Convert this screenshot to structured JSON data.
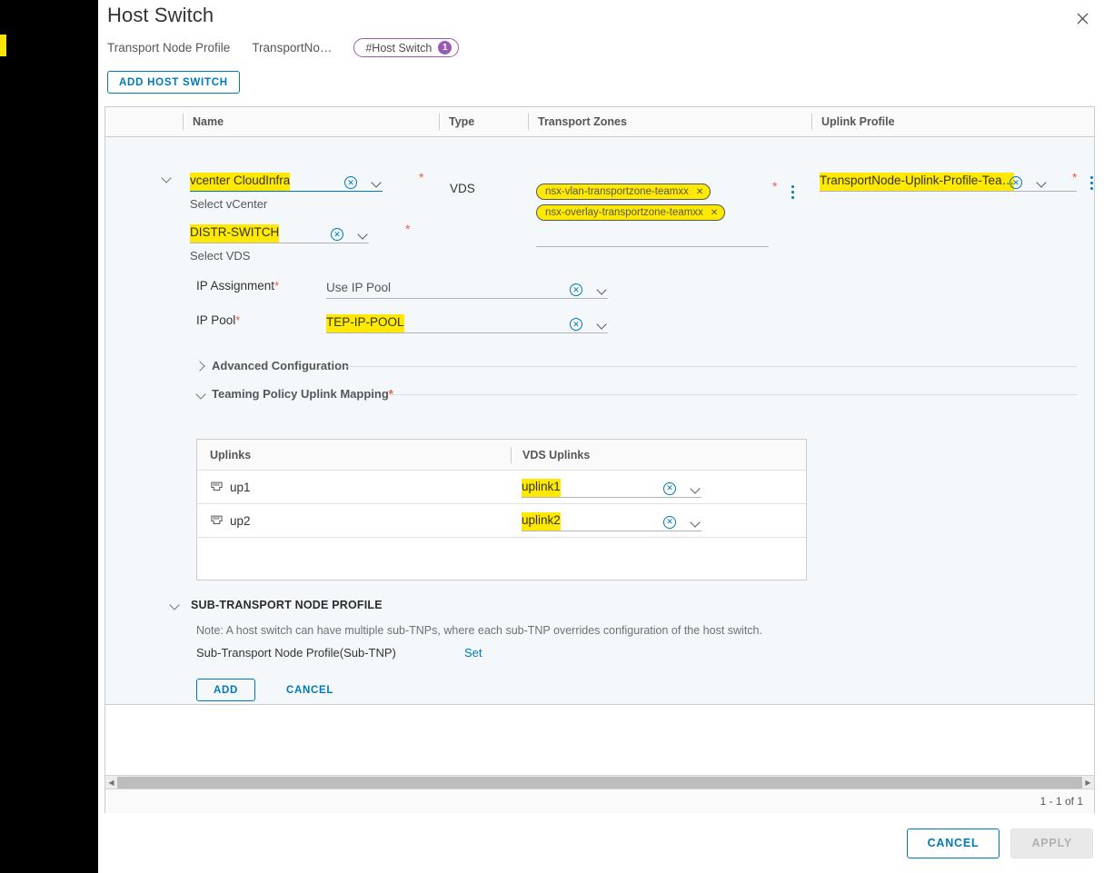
{
  "window": {
    "title": "Host Switch",
    "close_icon": "close-icon"
  },
  "breadcrumb": {
    "items": [
      {
        "label": "Transport Node Profile"
      },
      {
        "label": "TransportNo…"
      }
    ],
    "badge": {
      "label": "#Host Switch",
      "count": "1",
      "color": "#9b59b6"
    }
  },
  "toolbar": {
    "add_host_switch_label": "ADD HOST SWITCH"
  },
  "grid": {
    "columns": [
      {
        "key": "expand",
        "label": ""
      },
      {
        "key": "name",
        "label": "Name"
      },
      {
        "key": "type",
        "label": "Type"
      },
      {
        "key": "transport_zones",
        "label": "Transport Zones"
      },
      {
        "key": "uplink_profile",
        "label": "Uplink Profile"
      }
    ],
    "row": {
      "vcenter": {
        "value": "vcenter CloudInfra",
        "helper": "Select vCenter",
        "required": "*",
        "highlight": "#ffe900"
      },
      "vds": {
        "value": "DISTR-SWITCH",
        "helper": "Select VDS",
        "required": "*",
        "highlight": "#ffe900"
      },
      "type": "VDS",
      "transport_zones": [
        {
          "label": "nsx-vlan-transportzone-teamxx"
        },
        {
          "label": "nsx-overlay-transportzone-teamxx"
        }
      ],
      "transport_zones_required": "*",
      "uplink_profile": {
        "value": "TransportNode-Uplink-Profile-Tea…",
        "required": "*",
        "highlight": "#ffe900"
      }
    },
    "footer": {
      "pagination": "1 - 1 of 1"
    }
  },
  "form": {
    "ip_assignment": {
      "label": "IP Assignment",
      "required": "*",
      "value": "Use IP Pool"
    },
    "ip_pool": {
      "label": "IP Pool",
      "required": "*",
      "value": "TEP-IP-POOL",
      "highlight": "#ffe900"
    },
    "advanced_configuration": {
      "label": "Advanced Configuration",
      "expanded": "collapsed"
    },
    "teaming_policy": {
      "label": "Teaming Policy Uplink Mapping",
      "required": "*",
      "expanded": "expanded"
    }
  },
  "uplink_table": {
    "columns": [
      "Uplinks",
      "VDS Uplinks"
    ],
    "rows": [
      {
        "uplink": "up1",
        "vds_uplink": "uplink1",
        "highlight": "#ffe900"
      },
      {
        "uplink": "up2",
        "vds_uplink": "uplink2",
        "highlight": "#ffe900"
      }
    ]
  },
  "sub_tnp": {
    "section_title": "SUB-TRANSPORT NODE PROFILE",
    "note": "Note: A host switch can have multiple sub-TNPs, where each sub-TNP overrides configuration of the host switch.",
    "field_label": "Sub-Transport Node Profile(Sub-TNP)",
    "set_link": "Set"
  },
  "row_actions": {
    "add_label": "ADD",
    "cancel_label": "CANCEL"
  },
  "footer": {
    "cancel_label": "CANCEL",
    "apply_label": "APPLY"
  }
}
